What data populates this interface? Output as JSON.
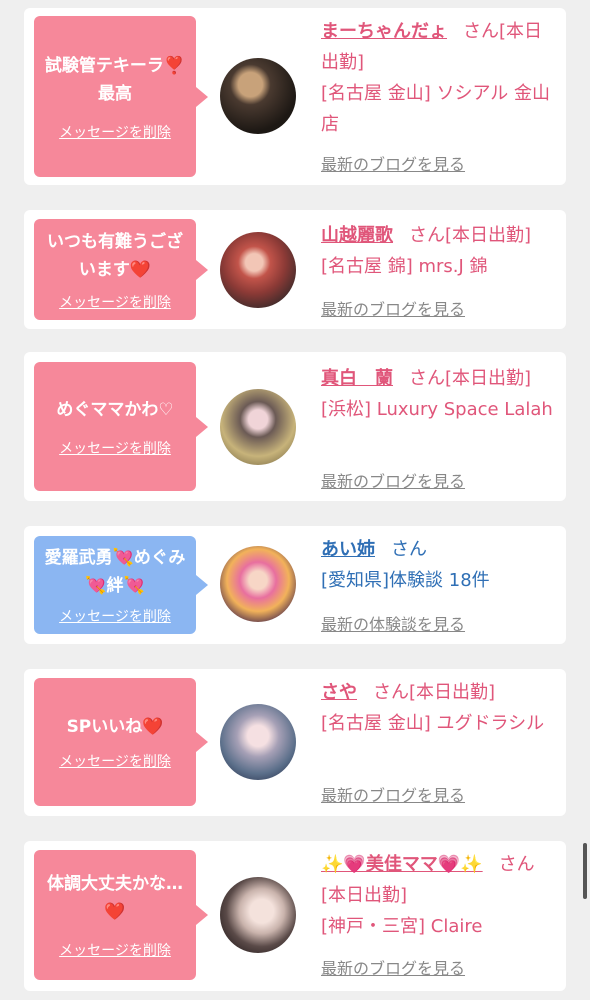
{
  "cards": [
    {
      "message": "試験管テキーラ❣️最高",
      "delete_label": "メッセージを削除",
      "name": "まーちゃんだょ",
      "san": "さん",
      "status": "[本日出勤]",
      "shop": "[名古屋 金山] ソシアル 金山店",
      "link": "最新のブログを見る",
      "color": "#f6889a"
    },
    {
      "message": "いつも有難うございます❤️",
      "delete_label": "メッセージを削除",
      "name": "山越麗歌",
      "san": "さん",
      "status": "[本日出勤]",
      "shop": "[名古屋 錦] mrs.J 錦",
      "link": "最新のブログを見る",
      "color": "#f6889a"
    },
    {
      "message": "めぐママかわ♡",
      "delete_label": "メッセージを削除",
      "name": "真白　蘭",
      "san": "さん",
      "status": "[本日出勤]",
      "shop": "[浜松] Luxury Space Lalah",
      "link": "最新のブログを見る",
      "color": "#f6889a"
    },
    {
      "message": "愛羅武勇💘めぐみ💘絆💘",
      "delete_label": "メッセージを削除",
      "name": "あい姉",
      "san": "さん",
      "status": "",
      "shop": "[愛知県]体験談 18件",
      "link": "最新の体験談を見る",
      "color": "#8bb6f2"
    },
    {
      "message": "SPいいね❤️",
      "delete_label": "メッセージを削除",
      "name": "さや",
      "san": "さん",
      "status": "[本日出勤]",
      "shop": "[名古屋 金山] ユグドラシル",
      "link": "最新のブログを見る",
      "color": "#f6889a"
    },
    {
      "message": "体調大丈夫かな…❤️",
      "delete_label": "メッセージを削除",
      "name": "✨💗美佳ママ💗✨",
      "san": "さん",
      "status": "[本日出勤]",
      "shop": "[神戸・三宮] Claire",
      "link": "最新のブログを見る",
      "color": "#f6889a"
    }
  ]
}
